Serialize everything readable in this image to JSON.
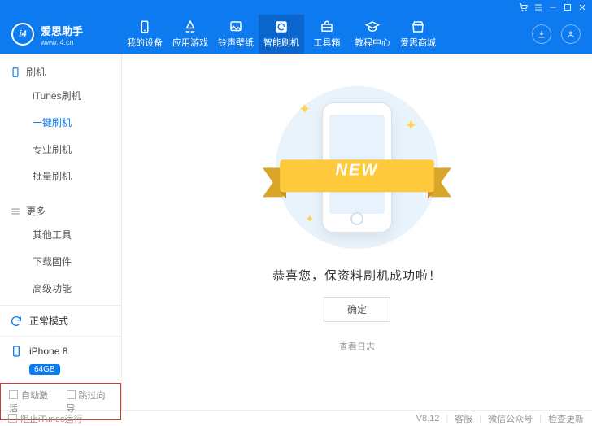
{
  "brand": {
    "logo_text": "i4",
    "title": "爱思助手",
    "site": "www.i4.cn"
  },
  "tabs": [
    {
      "label": "我的设备"
    },
    {
      "label": "应用游戏"
    },
    {
      "label": "铃声壁纸"
    },
    {
      "label": "智能刷机"
    },
    {
      "label": "工具箱"
    },
    {
      "label": "教程中心"
    },
    {
      "label": "爱思商城"
    }
  ],
  "sidebar": {
    "group1": {
      "title": "刷机",
      "items": [
        "iTunes刷机",
        "一键刷机",
        "专业刷机",
        "批量刷机"
      ]
    },
    "group2": {
      "title": "更多",
      "items": [
        "其他工具",
        "下载固件",
        "高级功能"
      ]
    },
    "mode": "正常模式",
    "device": {
      "name": "iPhone 8",
      "capacity": "64GB"
    },
    "redbox": {
      "auto_activate": "自动激活",
      "skip_wizard": "跳过向导"
    }
  },
  "content": {
    "ribbon": "NEW",
    "title": "恭喜您，保资料刷机成功啦！",
    "ok": "确定",
    "view_log": "查看日志"
  },
  "status": {
    "block_itunes": "阻止iTunes运行",
    "version": "V8.12",
    "service": "客服",
    "wechat": "微信公众号",
    "check_update": "检查更新"
  }
}
